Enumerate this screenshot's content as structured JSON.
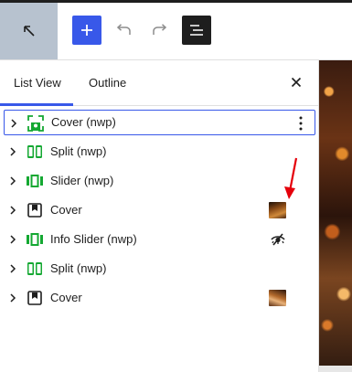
{
  "toolbar": {
    "home_icon": "arrow-up-left-icon",
    "add_icon": "plus-icon",
    "undo_icon": "undo-icon",
    "redo_icon": "redo-icon",
    "listview_icon": "list-view-icon"
  },
  "panel": {
    "tabs": [
      {
        "label": "List View",
        "active": true
      },
      {
        "label": "Outline",
        "active": false
      }
    ],
    "close_icon": "close-icon"
  },
  "blocks": [
    {
      "label": "Cover (nwp)",
      "icon": "cover-nwp-icon",
      "selected": true,
      "options": "more-vertical-icon"
    },
    {
      "label": "Split (nwp)",
      "icon": "split-icon"
    },
    {
      "label": "Slider (nwp)",
      "icon": "slider-icon"
    },
    {
      "label": "Cover",
      "icon": "cover-icon",
      "thumbnail": true
    },
    {
      "label": "Info Slider (nwp)",
      "icon": "info-slider-icon",
      "hidden_icon": "visibility-hidden-icon"
    },
    {
      "label": "Split (nwp)",
      "icon": "split-icon"
    },
    {
      "label": "Cover",
      "icon": "cover-icon",
      "thumbnail": true
    }
  ],
  "colors": {
    "accent": "#3858e9",
    "block_green": "#14a832",
    "annotation_red": "#e5000b",
    "dark": "#1e1e1e"
  }
}
